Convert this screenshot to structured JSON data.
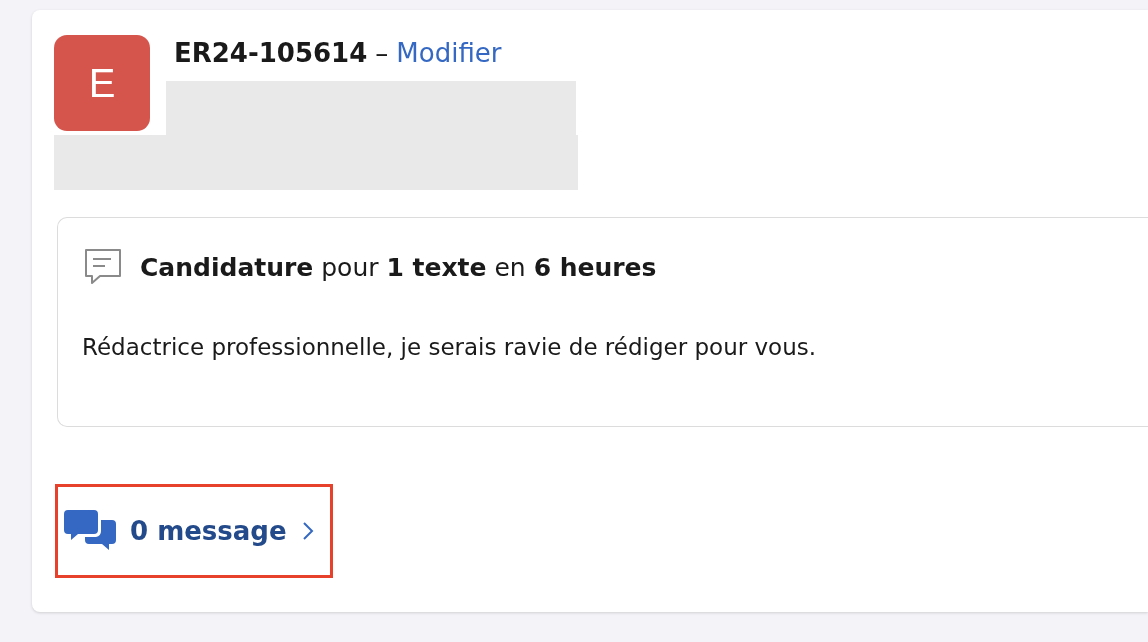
{
  "record": {
    "avatar": {
      "letter": "E",
      "color": "#d5554c"
    },
    "reference": "ER24-105614",
    "separator": "–",
    "edit_link": "Modifier"
  },
  "proposal": {
    "headline": "**Candidature** pour **1 texte** en **6 heures**",
    "message": "Rédactrice professionnelle, je serais ravie de rédiger pour vous."
  },
  "messages": {
    "label": "0 message",
    "highlighted": true
  }
}
